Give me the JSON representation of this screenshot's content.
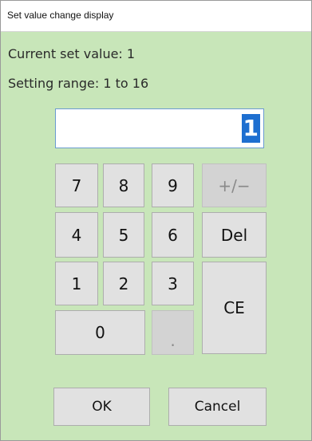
{
  "window": {
    "title": "Set value change display"
  },
  "info": {
    "current_label": "Current set value: 1",
    "range_label": "Setting range:  1 to 16"
  },
  "display": {
    "value": "1"
  },
  "keypad": {
    "k7": "7",
    "k8": "8",
    "k9": "9",
    "plusminus": "+/−",
    "k4": "4",
    "k5": "5",
    "k6": "6",
    "del": "Del",
    "k1": "1",
    "k2": "2",
    "k3": "3",
    "ce": "CE",
    "k0": "0",
    "dot": "."
  },
  "footer": {
    "ok": "OK",
    "cancel": "Cancel"
  },
  "colors": {
    "background": "#c8e6b9",
    "selection": "#1e6fd0",
    "button": "#e1e1e1",
    "button_disabled": "#d3d3d3"
  }
}
